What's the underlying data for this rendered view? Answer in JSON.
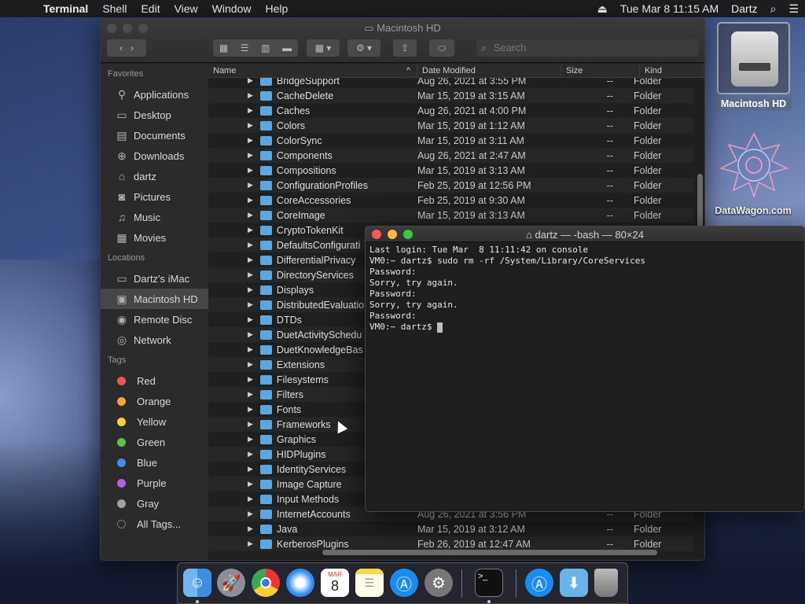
{
  "menubar": {
    "app": "Terminal",
    "items": [
      "Shell",
      "Edit",
      "View",
      "Window",
      "Help"
    ],
    "clock": "Tue Mar 8  11:15 AM",
    "user": "Dartz"
  },
  "finder": {
    "title": "Macintosh HD",
    "search_placeholder": "Search",
    "sidebar": {
      "favorites_label": "Favorites",
      "favorites": [
        {
          "label": "Applications",
          "icon": "applications-icon"
        },
        {
          "label": "Desktop",
          "icon": "desktop-icon"
        },
        {
          "label": "Documents",
          "icon": "documents-icon"
        },
        {
          "label": "Downloads",
          "icon": "downloads-icon"
        },
        {
          "label": "dartz",
          "icon": "home-icon"
        },
        {
          "label": "Pictures",
          "icon": "pictures-icon"
        },
        {
          "label": "Music",
          "icon": "music-icon"
        },
        {
          "label": "Movies",
          "icon": "movies-icon"
        }
      ],
      "locations_label": "Locations",
      "locations": [
        {
          "label": "Dartz's iMac",
          "icon": "imac-icon"
        },
        {
          "label": "Macintosh HD",
          "icon": "disk-icon"
        },
        {
          "label": "Remote Disc",
          "icon": "disc-icon"
        },
        {
          "label": "Network",
          "icon": "network-icon"
        }
      ],
      "tags_label": "Tags",
      "tags": [
        {
          "label": "Red",
          "color": "#f0554f"
        },
        {
          "label": "Orange",
          "color": "#f4a23b"
        },
        {
          "label": "Yellow",
          "color": "#f5d232"
        },
        {
          "label": "Green",
          "color": "#5ac43c"
        },
        {
          "label": "Blue",
          "color": "#3b8ff0"
        },
        {
          "label": "Purple",
          "color": "#b45ee0"
        },
        {
          "label": "Gray",
          "color": "#a0a0a0"
        }
      ],
      "all_tags": "All Tags..."
    },
    "columns": {
      "name": "Name",
      "date": "Date Modified",
      "size": "Size",
      "kind": "Kind"
    },
    "rows": [
      {
        "name": "BridgeSupport",
        "date": "Aug 26, 2021 at 3:55 PM",
        "size": "--",
        "kind": "Folder"
      },
      {
        "name": "CacheDelete",
        "date": "Mar 15, 2019 at 3:15 AM",
        "size": "--",
        "kind": "Folder"
      },
      {
        "name": "Caches",
        "date": "Aug 26, 2021 at 4:00 PM",
        "size": "--",
        "kind": "Folder"
      },
      {
        "name": "Colors",
        "date": "Mar 15, 2019 at 1:12 AM",
        "size": "--",
        "kind": "Folder"
      },
      {
        "name": "ColorSync",
        "date": "Mar 15, 2019 at 3:11 AM",
        "size": "--",
        "kind": "Folder"
      },
      {
        "name": "Components",
        "date": "Aug 26, 2021 at 2:47 AM",
        "size": "--",
        "kind": "Folder"
      },
      {
        "name": "Compositions",
        "date": "Mar 15, 2019 at 3:13 AM",
        "size": "--",
        "kind": "Folder"
      },
      {
        "name": "ConfigurationProfiles",
        "date": "Feb 25, 2019 at 12:56 PM",
        "size": "--",
        "kind": "Folder"
      },
      {
        "name": "CoreAccessories",
        "date": "Feb 25, 2019 at 9:30 AM",
        "size": "--",
        "kind": "Folder"
      },
      {
        "name": "CoreImage",
        "date": "Mar 15, 2019 at 3:13 AM",
        "size": "--",
        "kind": "Folder"
      },
      {
        "name": "CryptoTokenKit",
        "date": "",
        "size": "",
        "kind": ""
      },
      {
        "name": "DefaultsConfigurati",
        "date": "",
        "size": "",
        "kind": ""
      },
      {
        "name": "DifferentialPrivacy",
        "date": "",
        "size": "",
        "kind": ""
      },
      {
        "name": "DirectoryServices",
        "date": "",
        "size": "",
        "kind": ""
      },
      {
        "name": "Displays",
        "date": "",
        "size": "",
        "kind": ""
      },
      {
        "name": "DistributedEvaluatio",
        "date": "",
        "size": "",
        "kind": ""
      },
      {
        "name": "DTDs",
        "date": "",
        "size": "",
        "kind": ""
      },
      {
        "name": "DuetActivitySchedu",
        "date": "",
        "size": "",
        "kind": ""
      },
      {
        "name": "DuetKnowledgeBas",
        "date": "",
        "size": "",
        "kind": ""
      },
      {
        "name": "Extensions",
        "date": "",
        "size": "",
        "kind": ""
      },
      {
        "name": "Filesystems",
        "date": "",
        "size": "",
        "kind": ""
      },
      {
        "name": "Filters",
        "date": "",
        "size": "",
        "kind": ""
      },
      {
        "name": "Fonts",
        "date": "",
        "size": "",
        "kind": ""
      },
      {
        "name": "Frameworks",
        "date": "",
        "size": "",
        "kind": ""
      },
      {
        "name": "Graphics",
        "date": "",
        "size": "",
        "kind": ""
      },
      {
        "name": "HIDPlugins",
        "date": "",
        "size": "",
        "kind": ""
      },
      {
        "name": "IdentityServices",
        "date": "",
        "size": "",
        "kind": ""
      },
      {
        "name": "Image Capture",
        "date": "",
        "size": "",
        "kind": ""
      },
      {
        "name": "Input Methods",
        "date": "",
        "size": "",
        "kind": ""
      },
      {
        "name": "InternetAccounts",
        "date": "Aug 26, 2021 at 3:56 PM",
        "size": "--",
        "kind": "Folder"
      },
      {
        "name": "Java",
        "date": "Mar 15, 2019 at 3:12 AM",
        "size": "--",
        "kind": "Folder"
      },
      {
        "name": "KerberosPlugins",
        "date": "Feb 26, 2019 at 12:47 AM",
        "size": "--",
        "kind": "Folder"
      }
    ]
  },
  "terminal": {
    "title": "dartz — -bash — 80×24",
    "lines": [
      "Last login: Tue Mar  8 11:11:42 on console",
      "VM0:~ dartz$ sudo rm -rf /System/Library/CoreServices",
      "Password:",
      "Sorry, try again.",
      "Password:",
      "Sorry, try again.",
      "Password:",
      "VM0:~ dartz$ "
    ]
  },
  "desktop": {
    "hd_label": "Macintosh HD",
    "datawagon_label": "DataWagon.com"
  },
  "dock": {
    "calendar_month": "MAR",
    "calendar_day": "8"
  }
}
